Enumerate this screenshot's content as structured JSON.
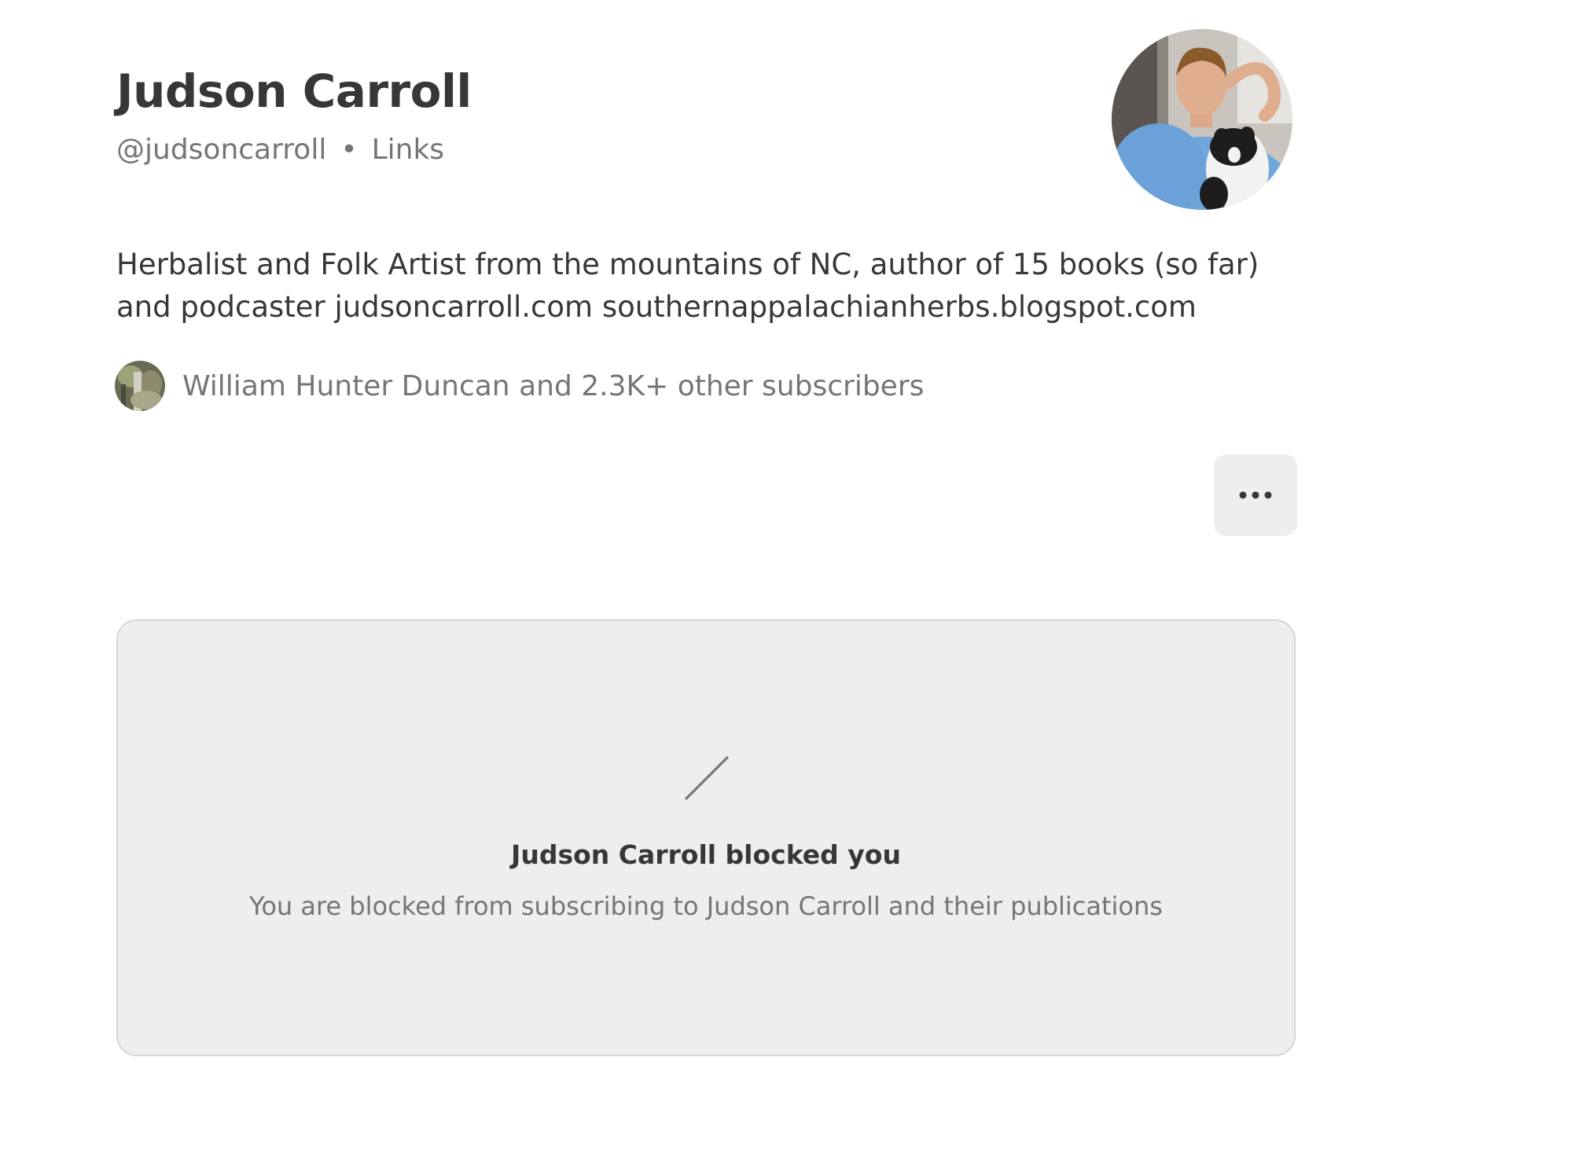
{
  "profile": {
    "name": "Judson Carroll",
    "handle": "@judsoncarroll",
    "separator": "•",
    "links_label": "Links",
    "bio": "Herbalist and Folk Artist from the mountains of NC, author of 15 books (so far) and podcaster judsoncarroll.com southernappalachianherbs.blogspot.com",
    "subscribers_text": "William Hunter Duncan and 2.3K+ other subscribers"
  },
  "actions": {
    "more_icon": "more-horizontal-icon"
  },
  "blocked": {
    "icon": "slash-icon",
    "title": "Judson Carroll blocked you",
    "description": "You are blocked from subscribing to Judson Carroll and their publications"
  },
  "colors": {
    "text_primary": "#363737",
    "text_secondary": "#757575",
    "card_background": "#eeeeee",
    "card_border": "#d6d6d6",
    "avatar_shirt": "#6fa6dc"
  }
}
